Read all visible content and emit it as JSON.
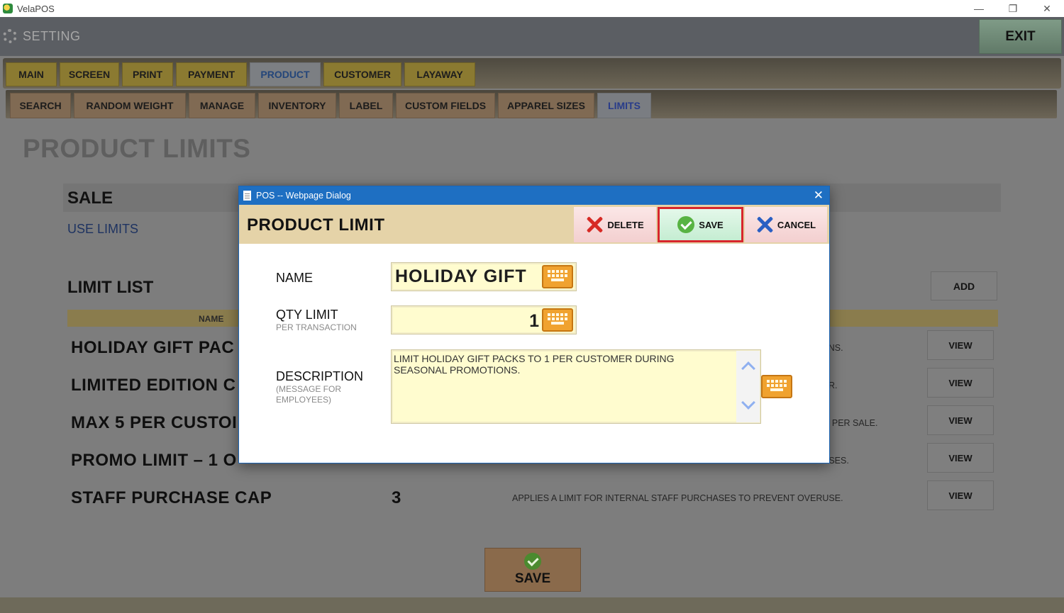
{
  "window": {
    "title": "VelaPOS",
    "minimize": "—",
    "restore": "❐",
    "close": "✕"
  },
  "header": {
    "title": "SETTING",
    "exit_label": "EXIT"
  },
  "main_tabs": [
    {
      "label": "MAIN"
    },
    {
      "label": "SCREEN"
    },
    {
      "label": "PRINT"
    },
    {
      "label": "PAYMENT"
    },
    {
      "label": "PRODUCT",
      "active": true
    },
    {
      "label": "CUSTOMER"
    },
    {
      "label": "LAYAWAY"
    }
  ],
  "sub_tabs": [
    {
      "label": "SEARCH"
    },
    {
      "label": "RANDOM WEIGHT"
    },
    {
      "label": "MANAGE"
    },
    {
      "label": "INVENTORY"
    },
    {
      "label": "LABEL"
    },
    {
      "label": "CUSTOM FIELDS"
    },
    {
      "label": "APPAREL SIZES"
    },
    {
      "label": "LIMITS",
      "active": true
    }
  ],
  "page": {
    "title": "PRODUCT LIMITS",
    "sale_section": "SALE",
    "use_limits_label": "USE LIMITS",
    "limit_list_title": "LIMIT LIST",
    "add_label": "ADD",
    "column_name": "NAME",
    "rows": [
      {
        "name": "HOLIDAY GIFT PAC",
        "qty": "",
        "desc": "ONS.",
        "view": "VIEW"
      },
      {
        "name": "LIMITED EDITION C",
        "qty": "",
        "desc": "R.",
        "view": "VIEW"
      },
      {
        "name": "MAX 5 PER CUSTOI",
        "qty": "",
        "desc": "T PER SALE.",
        "view": "VIEW"
      },
      {
        "name": "PROMO LIMIT – 1 O",
        "qty": "",
        "desc": "ASES.",
        "view": "VIEW"
      },
      {
        "name": "STAFF PURCHASE CAP",
        "qty": "3",
        "desc": "APPLIES A LIMIT FOR INTERNAL STAFF PURCHASES TO PREVENT OVERUSE.",
        "view": "VIEW"
      }
    ],
    "save_label": "SAVE"
  },
  "dialog": {
    "window_title": "POS -- Webpage Dialog",
    "close": "✕",
    "title": "PRODUCT LIMIT",
    "delete_label": "DELETE",
    "save_label": "SAVE",
    "cancel_label": "CANCEL",
    "name_label": "NAME",
    "name_value": "HOLIDAY GIFT",
    "qty_label": "QTY LIMIT",
    "qty_sub": "PER TRANSACTION",
    "qty_value": "1",
    "desc_label": "DESCRIPTION",
    "desc_sub_1": "(MESSAGE FOR",
    "desc_sub_2": "EMPLOYEES)",
    "desc_value": "LIMIT HOLIDAY GIFT PACKS TO 1 PER CUSTOMER DURING SEASONAL PROMOTIONS."
  },
  "colors": {
    "dialog_titlebar": "#1e6fc2",
    "highlight_border": "#d8262c",
    "input_bg": "#fffccf",
    "keyboard_icon": "#f0a22f"
  }
}
